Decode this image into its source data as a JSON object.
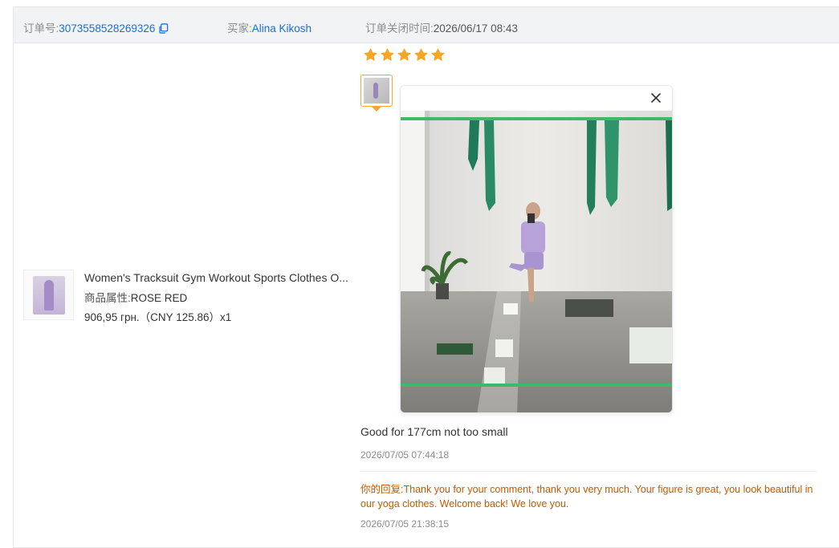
{
  "header": {
    "order_label": "订单号:",
    "order_number": "3073558528269326",
    "buyer_label": "买家:",
    "buyer_name": "Alina Kikosh",
    "closed_label": "订单关闭时间:",
    "closed_time": "2026/06/17 08:43"
  },
  "product": {
    "title": "Women's Tracksuit Gym Workout Sports Clothes O...",
    "attr_label": "商品属性:",
    "attr_value": "ROSE RED",
    "price": "906,95 грн.（CNY  125.86）x1"
  },
  "review": {
    "rating": 5,
    "comment": "Good for 177cm not too small",
    "comment_time": "2026/07/05 07:44:18",
    "reply_label": "你的回复:",
    "reply_text": "Thank you for your comment, thank you very much. Your figure is great, you look beautiful in our yoga clothes. Welcome back! We love you.",
    "reply_time": "2026/07/05 21:38:15"
  },
  "colors": {
    "link": "#1a6fd6",
    "star": "#f5a623",
    "reply": "#c15a00",
    "thumb_border": "#f0a830"
  },
  "icons": {
    "copy": "copy-icon",
    "star": "star-icon",
    "close": "close-icon"
  }
}
